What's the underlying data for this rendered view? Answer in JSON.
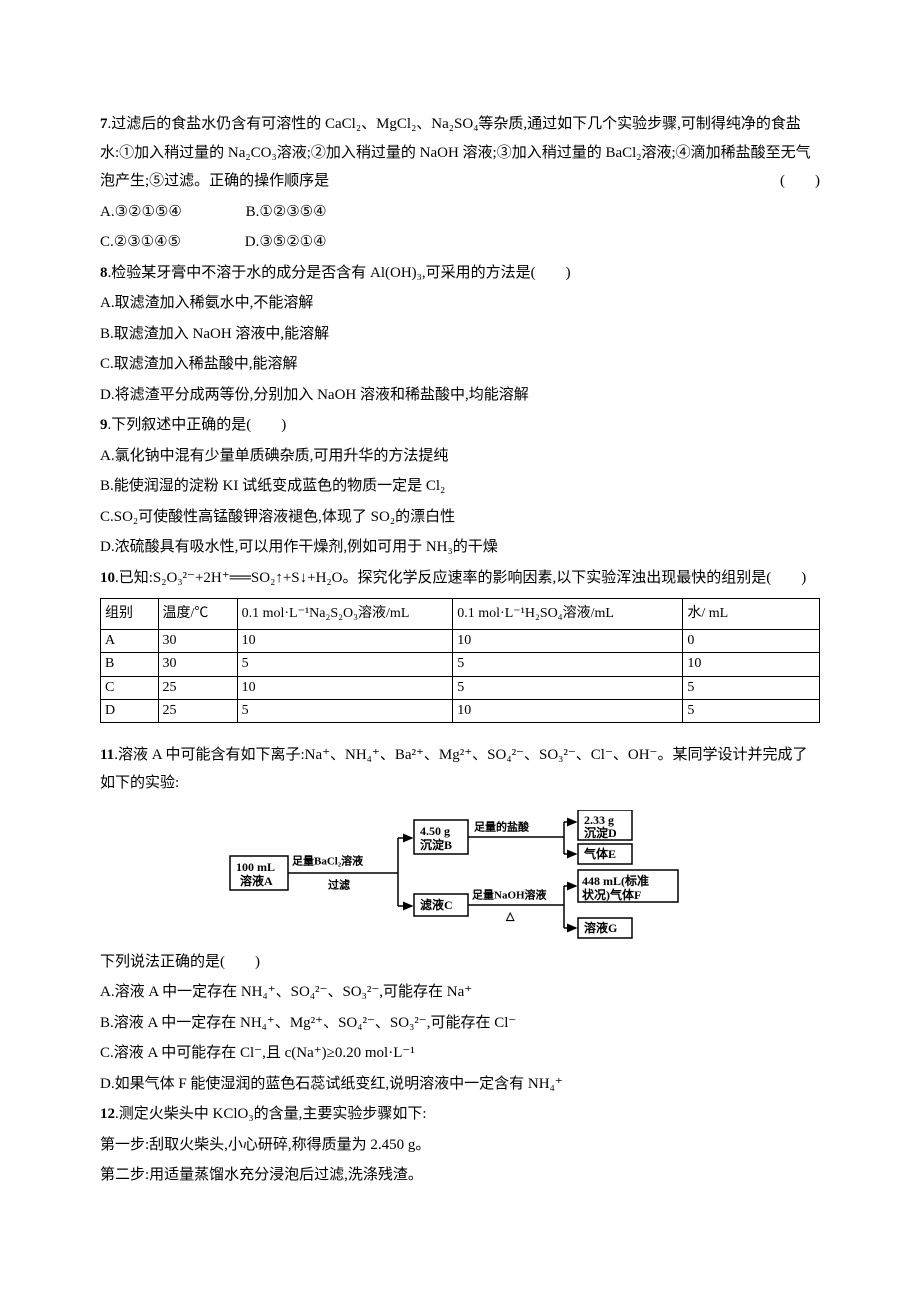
{
  "q7": {
    "num": "7",
    "text": ".过滤后的食盐水仍含有可溶性的 CaCl₂、MgCl₂、Na₂SO₄等杂质,通过如下几个实验步骤,可制得纯净的食盐水:①加入稍过量的 Na₂CO₃溶液;②加入稍过量的 NaOH 溶液;③加入稍过量的 BaCl₂溶液;④滴加稀盐酸至无气泡产生;⑤过滤。正确的操作顺序是",
    "paren": "(　　)",
    "A": "A.③②①⑤④",
    "B": "B.①②③⑤④",
    "C": "C.②③①④⑤",
    "D": "D.③⑤②①④"
  },
  "q8": {
    "num": "8",
    "text": ".检验某牙膏中不溶于水的成分是否含有 Al(OH)₃,可采用的方法是(　　)",
    "A": "A.取滤渣加入稀氨水中,不能溶解",
    "B": "B.取滤渣加入 NaOH 溶液中,能溶解",
    "C": "C.取滤渣加入稀盐酸中,能溶解",
    "D": "D.将滤渣平分成两等份,分别加入 NaOH 溶液和稀盐酸中,均能溶解"
  },
  "q9": {
    "num": "9",
    "text": ".下列叙述中正确的是(　　)",
    "A": "A.氯化钠中混有少量单质碘杂质,可用升华的方法提纯",
    "B": "B.能使润湿的淀粉 KI 试纸变成蓝色的物质一定是 Cl₂",
    "C": "C.SO₂可使酸性高锰酸钾溶液褪色,体现了 SO₂的漂白性",
    "D": "D.浓硫酸具有吸水性,可以用作干燥剂,例如可用于 NH₃的干燥"
  },
  "q10": {
    "num": "10",
    "text1": ".已知:S₂O₃²⁻+2H⁺══SO₂↑+S↓+H₂O。探究化学反应速率的影响因素,以下实验浑浊出现最快的组别是(　　)",
    "headers": [
      "组别",
      "温度/℃",
      "0.1 mol·L⁻¹Na₂S₂O₃溶液/mL",
      "0.1 mol·L⁻¹H₂SO₄溶液/mL",
      "水/ mL"
    ],
    "rows": [
      [
        "A",
        "30",
        "10",
        "10",
        "0"
      ],
      [
        "B",
        "30",
        "5",
        "5",
        "10"
      ],
      [
        "C",
        "25",
        "10",
        "5",
        "5"
      ],
      [
        "D",
        "25",
        "5",
        "10",
        "5"
      ]
    ]
  },
  "q11": {
    "num": "11",
    "text": ".溶液 A 中可能含有如下离子:Na⁺、NH₄⁺、Ba²⁺、Mg²⁺、SO₄²⁻、SO₃²⁻、Cl⁻、OH⁻。某同学设计并完成了如下的实验:",
    "diag": {
      "b1a": "100 mL",
      "b1b": "溶液A",
      "l1": "足量BaCl₂溶液",
      "l2": "过滤",
      "b2a": "4.50 g",
      "b2b": "沉淀B",
      "b3": "滤液C",
      "l3": "足量的盐酸",
      "l4": "足量NaOH溶液",
      "l5": "△",
      "b4a": "2.33 g",
      "b4b": "沉淀D",
      "b5": "气体E",
      "b6a": "448 mL(标准",
      "b6b": "状况)气体F",
      "b7": "溶液G"
    },
    "after": "下列说法正确的是(　　)",
    "A": "A.溶液 A 中一定存在 NH₄⁺、SO₄²⁻、SO₃²⁻,可能存在 Na⁺",
    "B": "B.溶液 A 中一定存在 NH₄⁺、Mg²⁺、SO₄²⁻、SO₃²⁻,可能存在 Cl⁻",
    "C": "C.溶液 A 中可能存在 Cl⁻,且 c(Na⁺)≥0.20 mol·L⁻¹",
    "D": "D.如果气体 F 能使湿润的蓝色石蕊试纸变红,说明溶液中一定含有 NH₄⁺"
  },
  "q12": {
    "num": "12",
    "text": ".测定火柴头中 KClO₃的含量,主要实验步骤如下:",
    "s1": "第一步:刮取火柴头,小心研碎,称得质量为 2.450 g。",
    "s2": "第二步:用适量蒸馏水充分浸泡后过滤,洗涤残渣。"
  }
}
